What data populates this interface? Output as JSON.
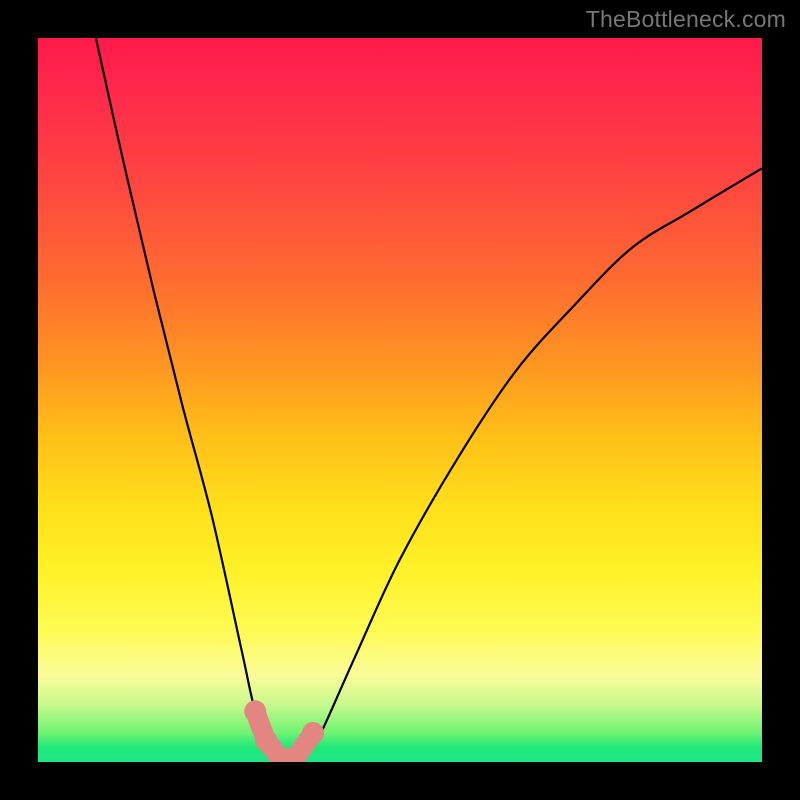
{
  "watermark": {
    "text": "TheBottleneck.com"
  },
  "colors": {
    "frame": "#000000",
    "curve": "#000000",
    "marker_fill": "#e38580",
    "gradient_stops": [
      "#ff1a4b",
      "#ff2a4b",
      "#ff4640",
      "#ff6a30",
      "#ff9522",
      "#ffbf18",
      "#ffe01a",
      "#fff22a",
      "#fffb55",
      "#fafc9a",
      "#c8f98b",
      "#6ef273",
      "#1fe87a",
      "#1fe686"
    ]
  },
  "chart_data": {
    "type": "line",
    "title": "",
    "xlabel": "",
    "ylabel": "",
    "xlim": [
      0,
      100
    ],
    "ylim": [
      0,
      100
    ],
    "note": "V-shaped bottleneck curve; y is % mismatch (0 = ideal). Minimum plateau near x≈31–38. Axes have no visible tick labels.",
    "series": [
      {
        "name": "bottleneck-curve",
        "x": [
          8,
          12,
          16,
          20,
          24,
          28,
          30,
          32,
          34,
          36,
          38,
          40,
          44,
          50,
          58,
          66,
          74,
          82,
          90,
          100
        ],
        "values": [
          100,
          82,
          65,
          49,
          34,
          16,
          7,
          2,
          0,
          0,
          2,
          6,
          15,
          28,
          42,
          54,
          63,
          71,
          76,
          82
        ]
      }
    ],
    "markers": {
      "name": "highlighted-points",
      "x": [
        30,
        31.5,
        33.5,
        35.5,
        38
      ],
      "values": [
        7,
        3,
        0.5,
        0.5,
        4
      ]
    }
  }
}
